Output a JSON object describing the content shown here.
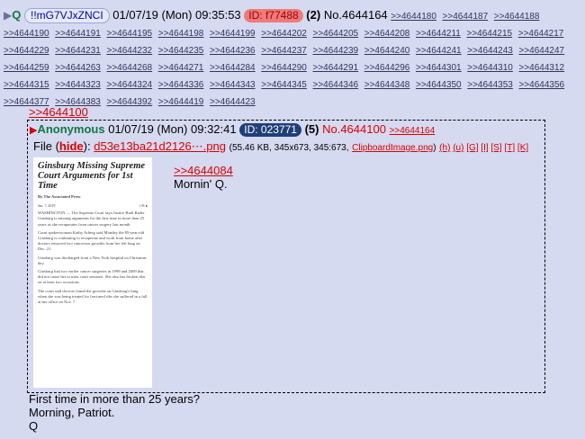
{
  "post": {
    "arrow": "▶",
    "name": "Q",
    "tripcode": "!!mG7VJxZNCI",
    "datetime": "01/07/19 (Mon) 09:35:53",
    "id_label": "ID: f77488",
    "reply_count": "(2)",
    "number": "No.4644164",
    "backlinks": [
      ">>4644180",
      ">>4644187",
      ">>4644188",
      ">>4644190",
      ">>4644191",
      ">>4644195",
      ">>4644198",
      ">>4644199",
      ">>4644202",
      ">>4644205",
      ">>4644208",
      ">>4644211",
      ">>4644215",
      ">>4644217",
      ">>4644229",
      ">>4644231",
      ">>4644232",
      ">>4644235",
      ">>4644236",
      ">>4644237",
      ">>4644239",
      ">>4644240",
      ">>4644241",
      ">>4644243",
      ">>4644247",
      ">>4644259",
      ">>4644263",
      ">>4644268",
      ">>4644271",
      ">>4644284",
      ">>4644290",
      ">>4644291",
      ">>4644296",
      ">>4644301",
      ">>4644310",
      ">>4644312",
      ">>4644315",
      ">>4644323",
      ">>4644324",
      ">>4644336",
      ">>4644343",
      ">>4644345",
      ">>4644346",
      ">>4644348",
      ">>4644350",
      ">>4644353",
      ">>4644356",
      ">>4644377",
      ">>4644383",
      ">>4644392",
      ">>4644419",
      ">>4644423"
    ],
    "quote_link": ">>4644100",
    "body_lines": [
      "First time in more than 25 years?",
      "Morning, Patriot.",
      "Q"
    ]
  },
  "quoted": {
    "arrow": "▶",
    "name": "Anonymous",
    "datetime": "01/07/19 (Mon) 09:32:41",
    "id_label": "ID: 023771",
    "reply_count": "(5)",
    "number": "No.4644100",
    "backlink": ">>4644164",
    "file_label": "File",
    "hide_open": "(",
    "hide": "hide",
    "hide_close": "):",
    "filename": "d53e13ba21d2126⋯.png",
    "file_meta": "(55.46 KB, 345x673, 345:673,",
    "orig_filename": "ClipboardImage.png",
    "file_meta_close": ")",
    "file_tools": [
      "(h)",
      "(u)",
      "[G]",
      "[I]",
      "[S]",
      "[T]",
      "[K]"
    ],
    "reply_link": ">>4644084",
    "body": "Mornin' Q.",
    "thumbnail": {
      "title": "Ginsburg Missing Supreme Court Arguments for 1st Time",
      "byline": "By The Associated Press",
      "date": "Jan. 7, 2019",
      "share_icons": "f  ✉  ●",
      "paragraphs": [
        "WASHINGTON — The Supreme Court says Justice Ruth Bader Ginsburg is missing arguments for the first time in more than 25 years as she recuperates from cancer surgery last month.",
        "Court spokeswoman Kathy Arberg said Monday the 85-year-old Ginsburg is continuing to recuperate and work from home after doctors removed two cancerous growths from her left lung on Dec. 21.",
        "Ginsburg was discharged from a New York hospital on Christmas day.",
        "Ginsburg had two earlier cancer surgeries in 1999 and 2009 that did not cause her to miss court sessions. She also has broken ribs on at least two occasions.",
        "The court said doctors found the growths on Ginsburg's lung when she was being treated for fractured ribs she suffered in a fall at her office on Nov. 7."
      ]
    }
  },
  "colors": {
    "background": "#d6daf0",
    "name": "#117743",
    "link": "#34345c",
    "quote": "#dd0000",
    "id_red": "#f07a7a",
    "id_blue": "#1f3f78"
  }
}
